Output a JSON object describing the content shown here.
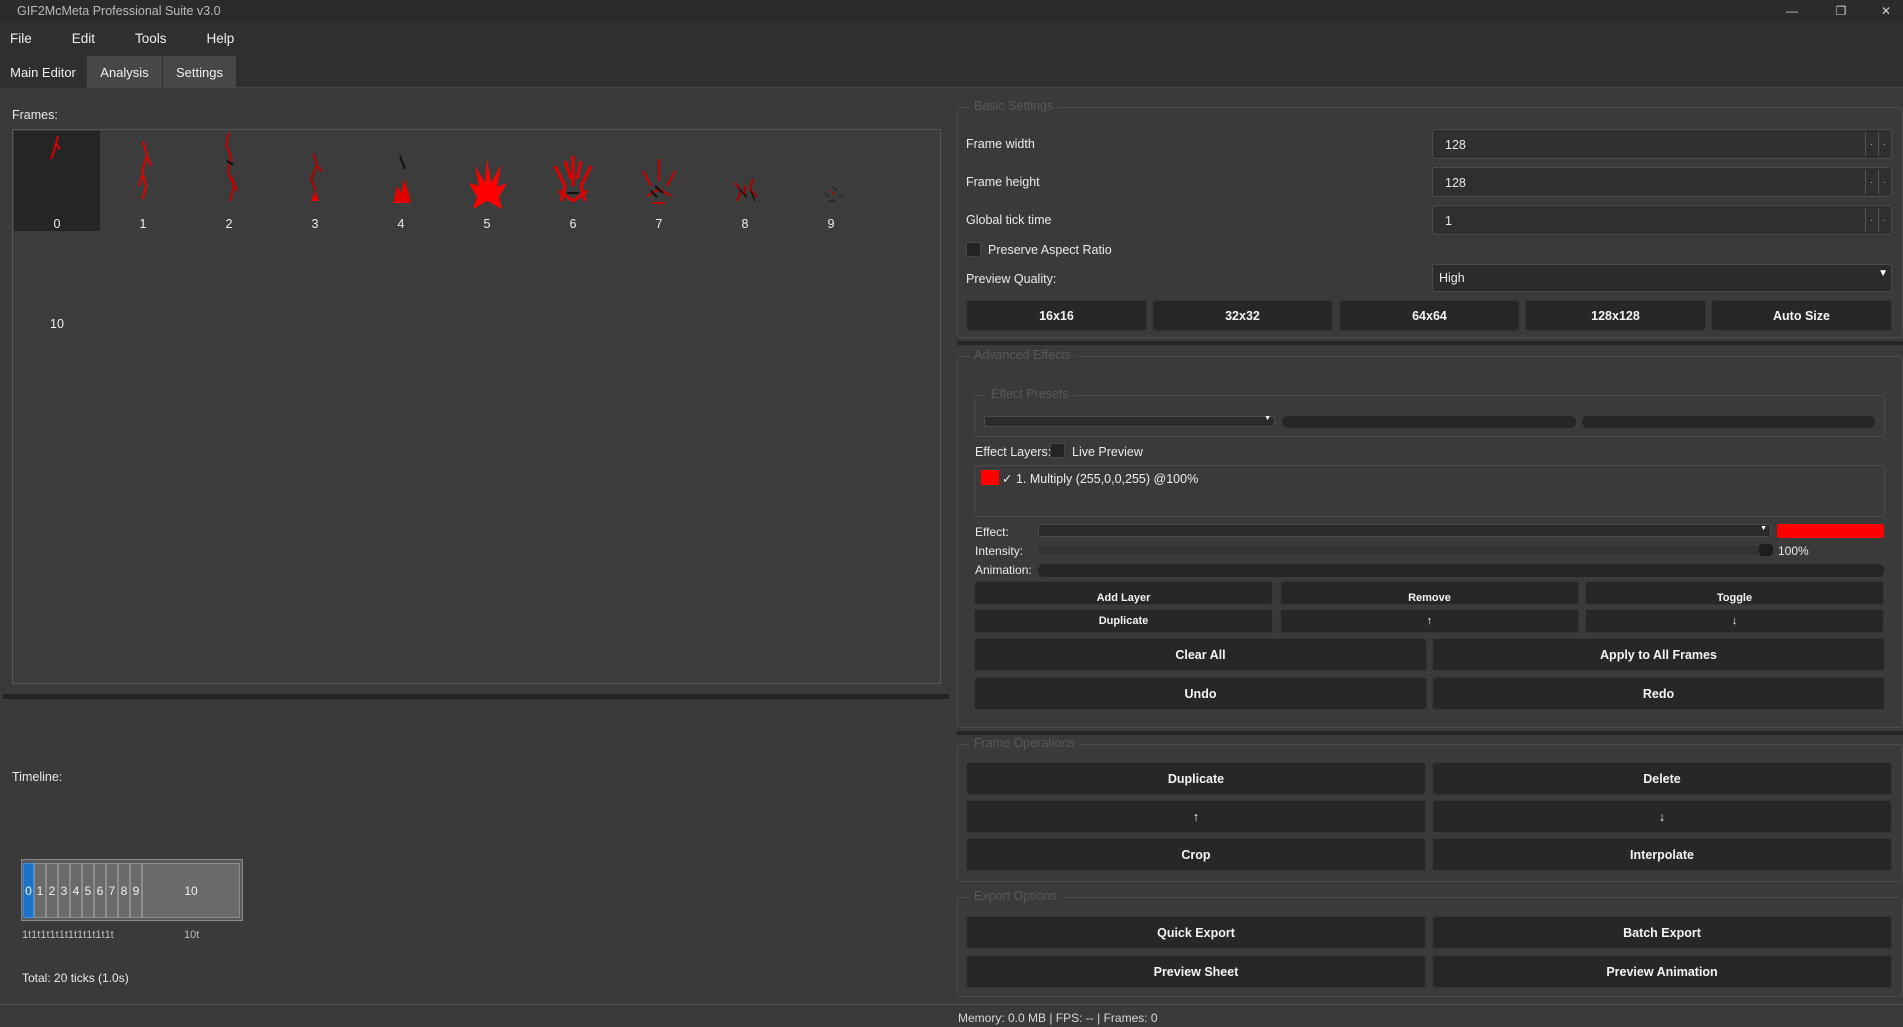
{
  "window": {
    "title": "GIF2McMeta Professional Suite v3.0",
    "minimize_glyph": "—",
    "restore_glyph": "❐",
    "close_glyph": "✕"
  },
  "menu": [
    "File",
    "Edit",
    "Tools",
    "Help"
  ],
  "tabs": [
    {
      "label": "Main Editor",
      "active": true
    },
    {
      "label": "Analysis",
      "active": false
    },
    {
      "label": "Settings",
      "active": false
    }
  ],
  "frames": {
    "label": "Frames:",
    "items": [
      "0",
      "1",
      "2",
      "3",
      "4",
      "5",
      "6",
      "7",
      "8",
      "9",
      "10"
    ],
    "selected_index": 0,
    "accent_color": "#e00000"
  },
  "timeline": {
    "label": "Timeline:",
    "blocks": [
      "0",
      "1",
      "2",
      "3",
      "4",
      "5",
      "6",
      "7",
      "8",
      "9",
      "10"
    ],
    "ticks": "1t1t1t1t1t1t1t1t1t1t",
    "last_tick": "10t",
    "total": "Total: 20 ticks (1.0s)",
    "selected_color": "#1e73c8"
  },
  "basic_settings": {
    "title": "Basic Settings",
    "frame_width_label": "Frame width",
    "frame_width": "128",
    "frame_height_label": "Frame height",
    "frame_height": "128",
    "tick_label": "Global tick time",
    "tick": "1",
    "preserve_label": "Preserve Aspect Ratio",
    "quality_label": "Preview Quality:",
    "quality_value": "High",
    "size_buttons": [
      "16x16",
      "32x32",
      "64x64",
      "128x128",
      "Auto Size"
    ]
  },
  "advanced_effects": {
    "title": "Advanced Effects",
    "presets_title": "Effect Presets",
    "layers_label": "Effect Layers:",
    "live_preview_label": "Live Preview",
    "layer_item": "✓ 1. Multiply (255,0,0,255) @100%",
    "layer_color": "#ff0000",
    "effect_label": "Effect:",
    "intensity_label": "Intensity:",
    "intensity_value": "100%",
    "intensity": 1.0,
    "animation_label": "Animation:",
    "layer_buttons": [
      "Add Layer",
      "Remove",
      "Toggle"
    ],
    "layer_buttons2": [
      "Duplicate",
      "↑",
      "↓"
    ],
    "clear_all": "Clear All",
    "apply_all": "Apply to All Frames",
    "undo": "Undo",
    "redo": "Redo"
  },
  "frame_operations": {
    "title": "Frame Operations",
    "duplicate": "Duplicate",
    "delete": "Delete",
    "up": "↑",
    "down": "↓",
    "crop": "Crop",
    "interpolate": "Interpolate"
  },
  "export_options": {
    "title": "Export Options",
    "quick": "Quick Export",
    "batch": "Batch Export",
    "sheet": "Preview Sheet",
    "animation": "Preview Animation"
  },
  "status": "Memory: 0.0 MB  |  FPS: --  |  Frames: 0"
}
